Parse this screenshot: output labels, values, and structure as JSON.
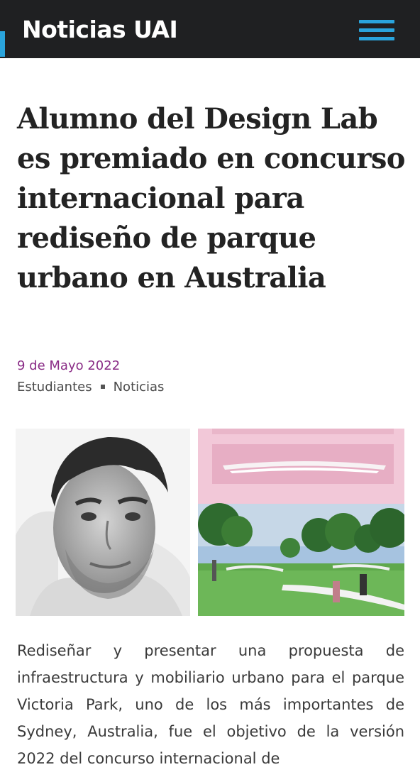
{
  "header": {
    "brand": "Noticias UAI",
    "menu_icon": "hamburger-menu-icon",
    "colors": {
      "bar": "#1f2022",
      "accent": "#2aa4dc"
    }
  },
  "article": {
    "title": "Alumno del Design Lab es premiado en concurso internacional para rediseño de parque urbano en Australia",
    "date": "9 de Mayo 2022",
    "categories": [
      "Estudiantes",
      "Noticias"
    ],
    "date_color": "#8a2c86",
    "body": "Rediseñar y presentar una propuesta de infraestructura y mobiliario urbano para el parque Victoria Park, uno de los más importantes de Sydney, Australia, fue el objetivo de la versión 2022 del concurso internacional de"
  }
}
